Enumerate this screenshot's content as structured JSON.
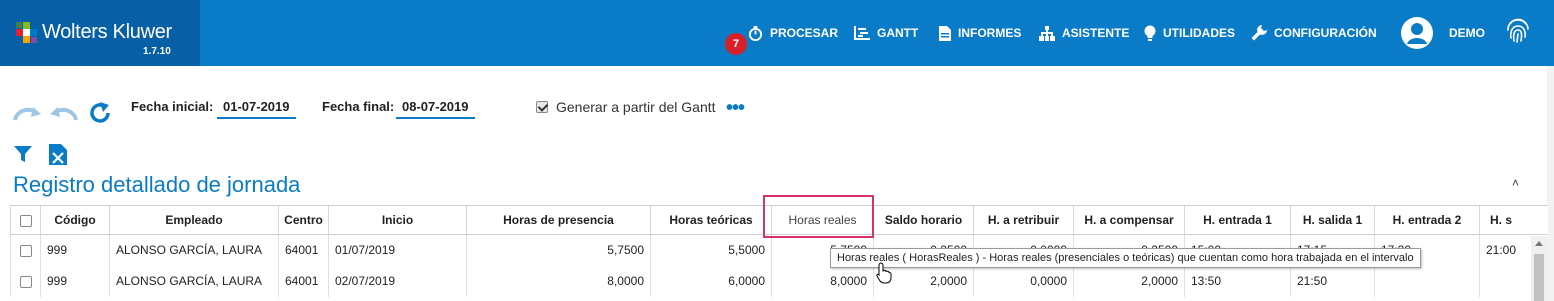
{
  "app": {
    "brand_name": "Wolters Kluwer",
    "version": "1.7.10",
    "accent_color": "#0a7bc6",
    "brand_bg_color": "#075fa5"
  },
  "nav": {
    "badge_count": "7",
    "procesar": "PROCESAR",
    "gantt": "GANTT",
    "informes": "INFORMES",
    "asistente": "ASISTENTE",
    "utilidades": "UTILIDADES",
    "configuracion": "CONFIGURACIÓN",
    "user": "DEMO",
    "icons": [
      "stopwatch-icon",
      "gantt-icon",
      "document-icon",
      "org-chart-icon",
      "lightbulb-icon",
      "wrench-icon",
      "user-avatar-icon",
      "fingerprint-icon"
    ]
  },
  "filters": {
    "fecha_inicial_label": "Fecha inicial:",
    "fecha_inicial_value": "01-07-2019",
    "fecha_final_label": "Fecha final:",
    "fecha_final_value": "08-07-2019",
    "generar_label": "Generar a partir del Gantt",
    "generar_checked": true,
    "more": "•••"
  },
  "section": {
    "title": "Registro detallado de jornada",
    "collapse": "˄"
  },
  "table": {
    "headers": [
      "Código",
      "Empleado",
      "Centro",
      "Inicio",
      "Horas de presencia",
      "Horas teóricas",
      "Horas reales",
      "Saldo horario",
      "H. a retribuir",
      "H. a compensar",
      "H. entrada 1",
      "H. salida 1",
      "H. entrada 2",
      "H. s"
    ],
    "rows": [
      [
        "999",
        "ALONSO GARCÍA, LAURA",
        "64001",
        "01/07/2019",
        "5,7500",
        "5,5000",
        "5,7500",
        "0,2500",
        "0,0000",
        "0,2500",
        "15:00",
        "17:15",
        "17:30",
        "21:00"
      ],
      [
        "999",
        "ALONSO GARCÍA, LAURA",
        "64001",
        "02/07/2019",
        "8,0000",
        "6,0000",
        "8,0000",
        "2,0000",
        "0,0000",
        "2,0000",
        "13:50",
        "21:50",
        "",
        ""
      ]
    ]
  },
  "tooltip": {
    "text": "Horas reales ( HorasReales ) - Horas reales (presenciales o teóricas) que cuentan como hora trabajada en el intervalo"
  }
}
